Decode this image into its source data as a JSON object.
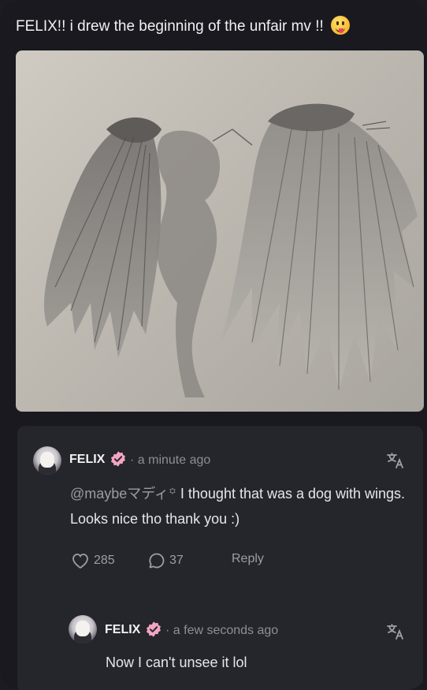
{
  "post": {
    "title": "FELIX!! i drew the beginning of the unfair mv !!",
    "emoji": "tongue-out-face"
  },
  "comments": [
    {
      "author": "FELIX",
      "time": "· a minute ago",
      "mention": "@maybeマディ꙳",
      "text": " I thought that was a dog with wings. Looks nice tho thank you :)",
      "likes": "285",
      "replies": "37",
      "reply_label": "Reply"
    },
    {
      "author": "FELIX",
      "time": "· a few seconds ago",
      "text": "Now I can't unsee it lol"
    }
  ],
  "colors": {
    "background": "#19191f",
    "panel": "#25252c",
    "badge": "#f3a5c1",
    "muted": "#8e8e97"
  }
}
